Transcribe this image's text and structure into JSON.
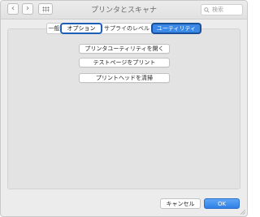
{
  "window": {
    "title": "プリンタとスキャナ",
    "search_placeholder": "検索"
  },
  "tabs": [
    {
      "label": "一般",
      "state": "normal"
    },
    {
      "label": "オプション",
      "state": "focused"
    },
    {
      "label": "サプライのレベル",
      "state": "normal"
    },
    {
      "label": "ユーティリティ",
      "state": "selected"
    }
  ],
  "actions": [
    {
      "label": "プリンタユーティリティを開く"
    },
    {
      "label": "テストページをプリント"
    },
    {
      "label": "プリントヘッドを清掃"
    }
  ],
  "footer": {
    "cancel_label": "キャンセル",
    "ok_label": "OK"
  },
  "icons": {
    "back": "chevron-left-icon",
    "forward": "chevron-right-icon",
    "grid": "grid-icon",
    "search": "search-icon"
  },
  "colors": {
    "accent": "#3b88e6",
    "focus_ring": "#1d5eb6"
  }
}
